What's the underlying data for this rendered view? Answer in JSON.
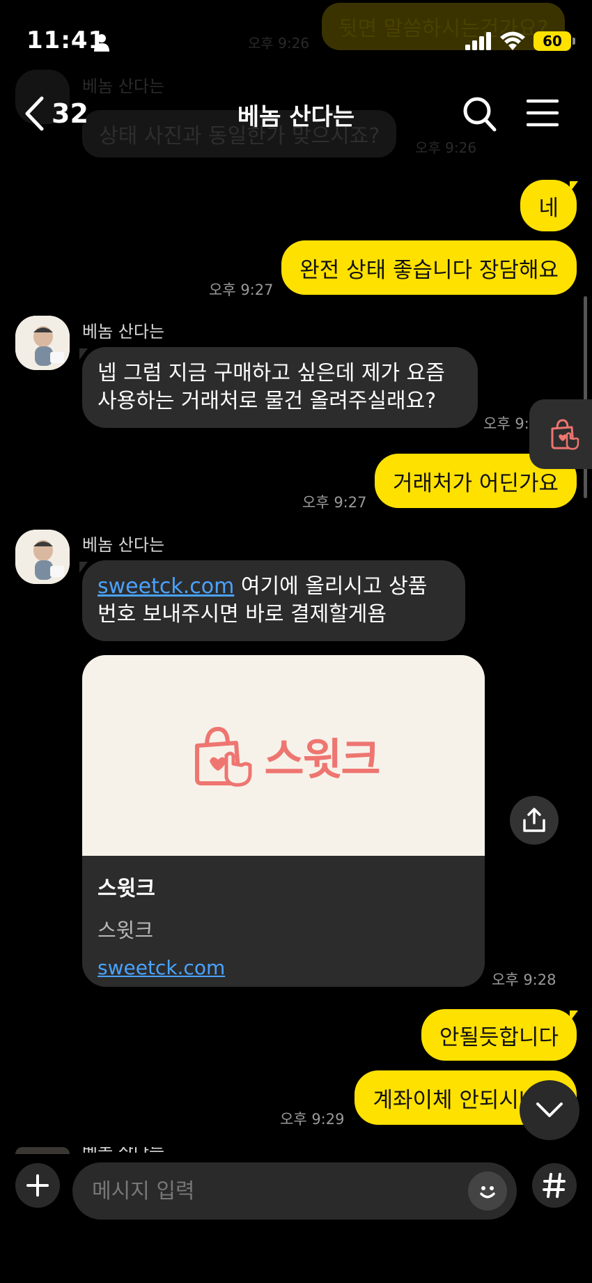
{
  "status_bar": {
    "time": "11:41",
    "battery": "60"
  },
  "header": {
    "back_count": "32",
    "title": "베놈 산다는"
  },
  "faded": {
    "top_out": "뒷면 말씀하시는건가요?",
    "top_time": "오후 9:26",
    "sender": "베놈 산다는",
    "in_msg": "상태 사진과 동일한가 맞으시죠?",
    "in_time": "오후 9:26"
  },
  "messages": [
    {
      "dir": "out",
      "text": "네"
    },
    {
      "dir": "out",
      "text": "완전 상태 좋습니다 장담해요",
      "time": "오후 9:27"
    },
    {
      "dir": "in",
      "sender": "베놈 산다는",
      "line1": "넵 그럼 지금 구매하고 싶은데 제가 요즘",
      "line2": "사용하는 거래처로 물건 올려주실래요?",
      "time": "오후 9:"
    },
    {
      "dir": "out",
      "text": "거래처가 어딘가요",
      "time": "오후 9:27"
    },
    {
      "dir": "in",
      "sender": "베놈 산다는",
      "link": "sweetck.com",
      "rest1": " 여기에 올리시고 상품",
      "line2": "번호 보내주시면 바로 결제할게욤",
      "time": "오후 9:28"
    },
    {
      "dir": "out",
      "text": "안될듯합니다"
    },
    {
      "dir": "out",
      "text": "계좌이체 안되시나요",
      "time": "오후 9:29"
    }
  ],
  "card": {
    "brand": "스윗크",
    "title": "스윗크",
    "desc": "스윗크",
    "url": "sweetck.com"
  },
  "bottom_sender_partial": "베놈 산다는",
  "input": {
    "placeholder": "메시지 입력"
  },
  "icons": {
    "back": "chevron-left-icon",
    "search": "search-icon",
    "menu": "hamburger-icon",
    "share": "share-icon",
    "shop": "shopping-bag-icon",
    "down": "chevron-down-icon",
    "plus": "plus-icon",
    "emoji": "emoji-icon",
    "hash": "hashtag-icon"
  },
  "colors": {
    "my_bubble": "#ffe100",
    "their_bubble": "#2c2c2c",
    "link": "#4aa3ff",
    "brand": "#ee7570"
  }
}
